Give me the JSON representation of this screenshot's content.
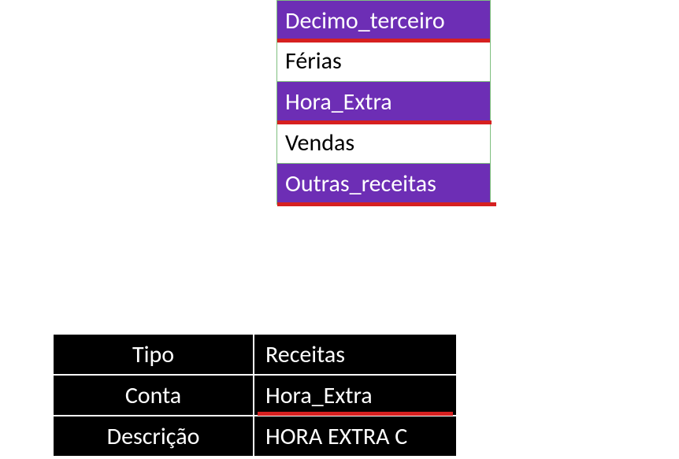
{
  "list": {
    "items": [
      {
        "label": "Decimo_terceiro",
        "styleClass": "purple",
        "underlineWidth": 270
      },
      {
        "label": "Férias",
        "styleClass": "white",
        "underlineWidth": 0
      },
      {
        "label": "Hora_Extra",
        "styleClass": "purple",
        "underlineWidth": 272
      },
      {
        "label": "Vendas",
        "styleClass": "white",
        "underlineWidth": 0
      },
      {
        "label": "Outras_receitas",
        "styleClass": "purple",
        "underlineWidth": 278
      }
    ]
  },
  "table": {
    "rows": [
      {
        "label": "Tipo",
        "value": "Receitas",
        "underlineWidth": 0
      },
      {
        "label": "Conta",
        "value": "Hora_Extra",
        "underlineWidth": 248
      },
      {
        "label": "Descrição",
        "value": "HORA EXTRA C",
        "underlineWidth": 0
      }
    ]
  }
}
